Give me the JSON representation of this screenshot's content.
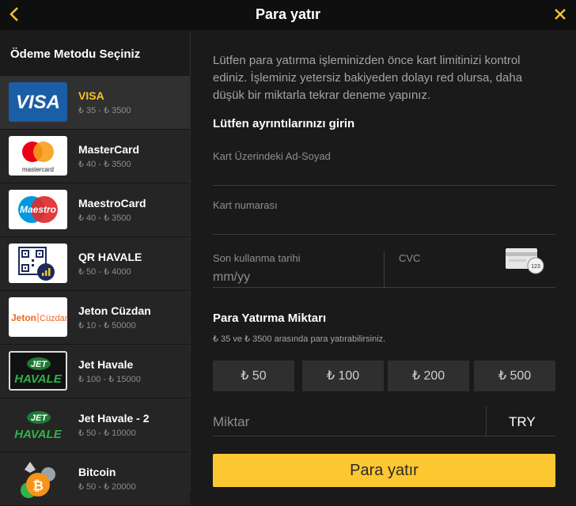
{
  "header": {
    "title": "Para yatır"
  },
  "sidebar": {
    "title": "Ödeme Metodu Seçiniz",
    "methods": [
      {
        "name": "VISA",
        "range": "₺ 35 - ₺ 3500",
        "logo_text": "VISA"
      },
      {
        "name": "MasterCard",
        "range": "₺ 40 - ₺ 3500",
        "logo_text": "mastercard"
      },
      {
        "name": "MaestroCard",
        "range": "₺ 40 - ₺ 3500",
        "logo_text": "Maestro"
      },
      {
        "name": "QR HAVALE",
        "range": "₺ 50 - ₺ 4000"
      },
      {
        "name": "Jeton Cüzdan",
        "range": "₺ 10 - ₺ 50000",
        "logo_text_1": "Jeton",
        "logo_text_2": "Cüzdan"
      },
      {
        "name": "Jet Havale",
        "range": "₺ 100 - ₺ 15000",
        "logo_text_1": "JET",
        "logo_text_2": "HAVALE"
      },
      {
        "name": "Jet Havale - 2",
        "range": "₺ 50 - ₺ 10000",
        "logo_text_1": "JET",
        "logo_text_2": "HAVALE"
      },
      {
        "name": "Bitcoin",
        "range": "₺ 50 - ₺ 20000"
      }
    ]
  },
  "form": {
    "notice": "Lütfen para yatırma işleminizden önce kart limitinizi kontrol ediniz. İşleminiz yetersiz bakiyeden dolayı red olursa, daha düşük bir miktarla tekrar deneme yapınız.",
    "details_title": "Lütfen ayrıntılarınızı girin",
    "name_label": "Kart Üzerindeki Ad-Soyad",
    "number_label": "Kart numarası",
    "expiry_label": "Son kullanma tarihi",
    "expiry_placeholder": "mm/yy",
    "cvc_label": "CVC",
    "cvc_icon_text": "123",
    "amount_title": "Para Yatırma Miktarı",
    "amount_hint": "₺ 35 ve ₺ 3500 arasında para yatırabilirsiniz.",
    "quick_amounts": [
      "₺ 50",
      "₺ 100",
      "₺ 200",
      "₺ 500"
    ],
    "amount_placeholder": "Miktar",
    "currency": "TRY",
    "submit_label": "Para yatır"
  },
  "colors": {
    "accent": "#f7c521",
    "button": "#fcc731",
    "visa_blue": "#1a5ea6"
  }
}
